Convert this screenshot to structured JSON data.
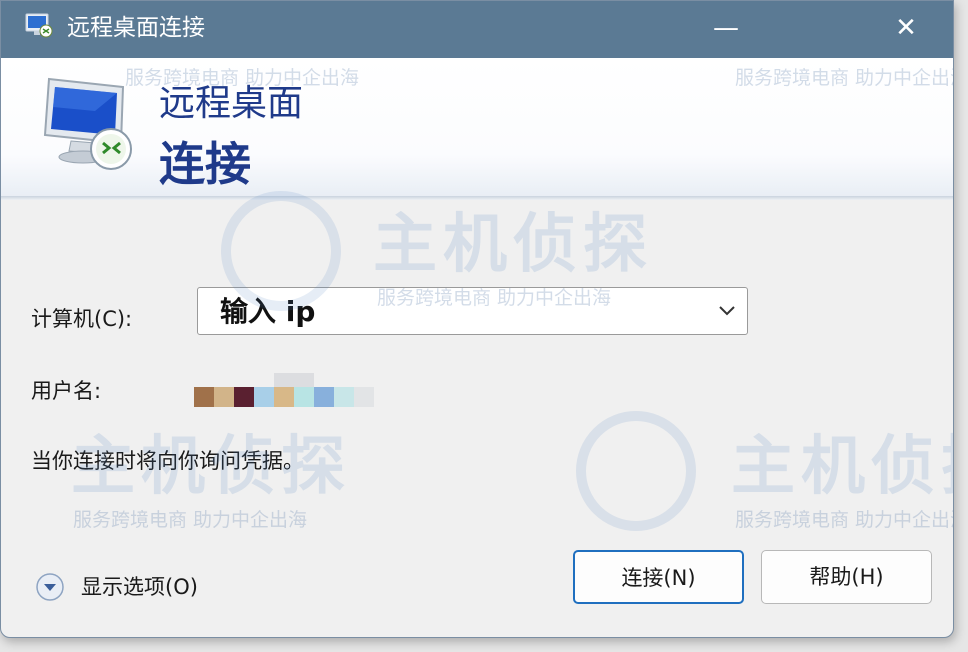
{
  "window": {
    "title": "远程桌面连接",
    "minimize_glyph": "—",
    "close_glyph": "✕"
  },
  "header": {
    "line1": "远程桌面",
    "line2": "连接"
  },
  "form": {
    "computer_label": "计算机(C):",
    "computer_value": "输入 ip",
    "username_label": "用户名:",
    "info_text": "当你连接时将向你询问凭据。"
  },
  "footer": {
    "options_label": "显示选项(O)",
    "connect_label": "连接(N)",
    "help_label": "帮助(H)"
  },
  "watermark": {
    "brand": "主机侦探",
    "slogan": "服务跨境电商 助力中企出海"
  },
  "colors": {
    "titlebar": "#5b7a94",
    "header_text": "#1f3a8a",
    "focus_border": "#1f6fbf",
    "window_bg": "#f0f0f0"
  },
  "icons": {
    "app": "remote-desktop-icon",
    "header": "monitor-remote-icon",
    "dropdown": "chevron-down-icon",
    "options": "expand-circle-icon"
  }
}
